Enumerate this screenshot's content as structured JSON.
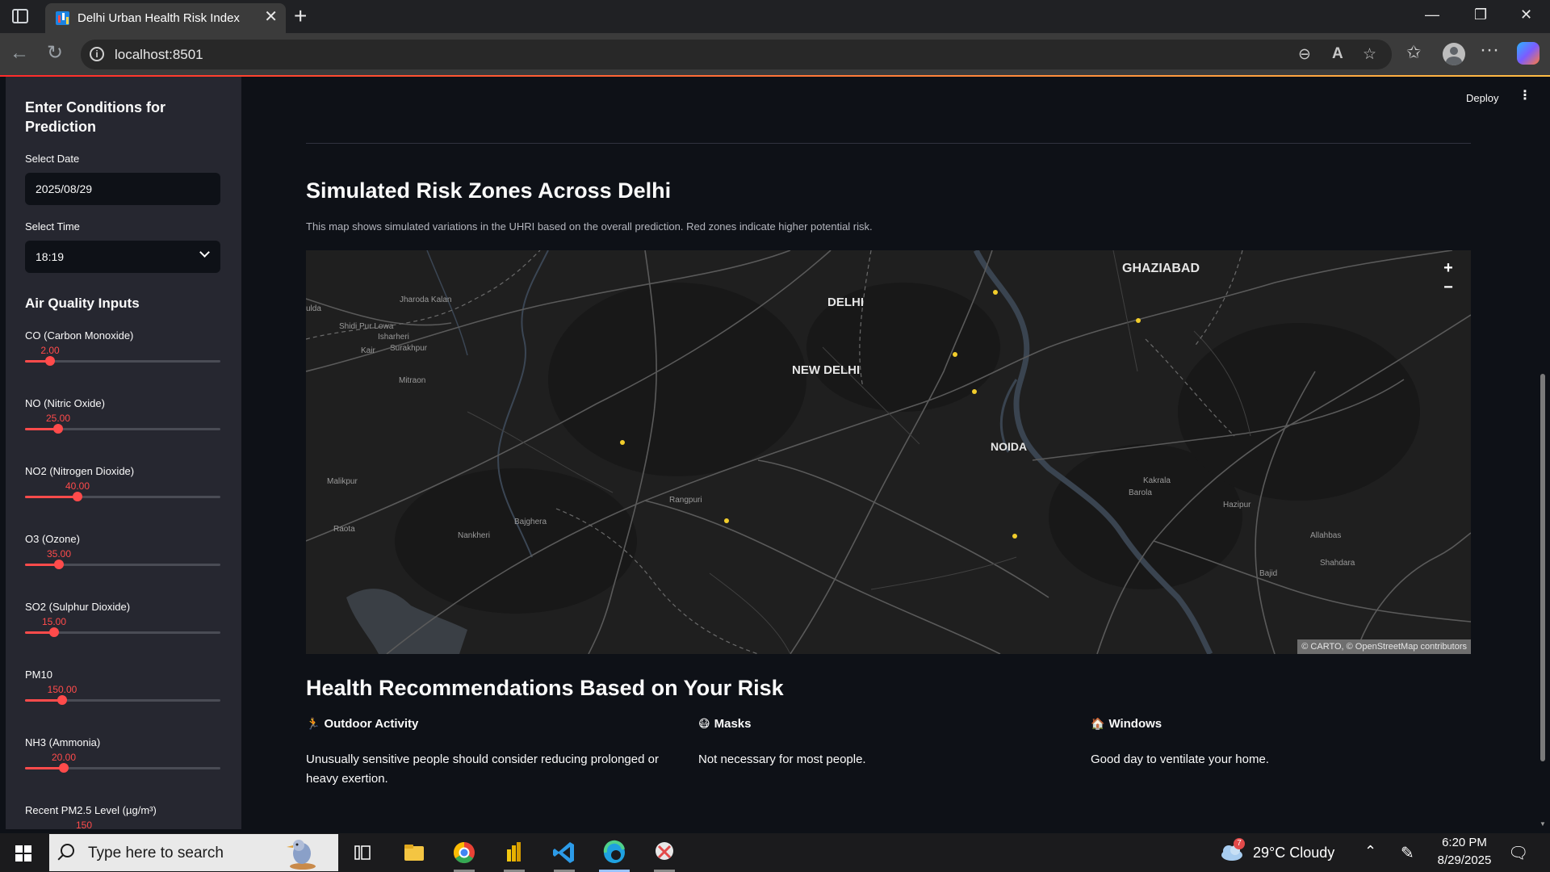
{
  "browser": {
    "tab_title": "Delhi Urban Health Risk Index",
    "url": "localhost:8501"
  },
  "app": {
    "deploy_label": "Deploy"
  },
  "sidebar": {
    "heading": "Enter Conditions for Prediction",
    "date_label": "Select Date",
    "date_value": "2025/08/29",
    "time_label": "Select Time",
    "time_value": "18:19",
    "aq_heading": "Air Quality Inputs",
    "sliders": [
      {
        "label": "CO (Carbon Monoxide)",
        "value": "2.00",
        "fraction": 0.13
      },
      {
        "label": "NO (Nitric Oxide)",
        "value": "25.00",
        "fraction": 0.17
      },
      {
        "label": "NO2 (Nitrogen Dioxide)",
        "value": "40.00",
        "fraction": 0.27
      },
      {
        "label": "O3 (Ozone)",
        "value": "35.00",
        "fraction": 0.175
      },
      {
        "label": "SO2 (Sulphur Dioxide)",
        "value": "15.00",
        "fraction": 0.15
      },
      {
        "label": "PM10",
        "value": "150.00",
        "fraction": 0.19
      },
      {
        "label": "NH3 (Ammonia)",
        "value": "20.00",
        "fraction": 0.2
      },
      {
        "label": "Recent PM2.5 Level (µg/m³)",
        "value": "150",
        "fraction": 0.3
      }
    ]
  },
  "main": {
    "map_section": {
      "title": "Simulated Risk Zones Across Delhi",
      "caption": "This map shows simulated variations in the UHRI based on the overall prediction. Red zones indicate higher potential risk.",
      "labels_major": [
        "GHAZIABAD",
        "DELHI",
        "NEW DELHI",
        "NOIDA"
      ],
      "labels_minor": [
        "Jharoda Kalan",
        "ulda",
        "Shidi Pur Lowa",
        "Isharheri",
        "Kair",
        "Surakhpur",
        "Mitraon",
        "Malikpur",
        "Raota",
        "Nankheri",
        "Bajghera",
        "Rangpuri",
        "Kakrala",
        "Barola",
        "Hazipur",
        "Allahbas",
        "Shahdara",
        "Bajid"
      ],
      "zoom_in": "+",
      "zoom_out": "−",
      "attribution": "© CARTO, © OpenStreetMap contributors"
    },
    "recommendations": {
      "title": "Health Recommendations Based on Your Risk",
      "items": [
        {
          "icon": "running-person-icon",
          "title": "Outdoor Activity",
          "text": "Unusually sensitive people should consider reducing prolonged or heavy exertion."
        },
        {
          "icon": "mask-face-icon",
          "title": "Masks",
          "text": "Not necessary for most people."
        },
        {
          "icon": "house-icon",
          "title": "Windows",
          "text": "Good day to ventilate your home."
        }
      ]
    }
  },
  "taskbar": {
    "search_placeholder": "Type here to search",
    "weather_badge": "7",
    "weather": "29°C  Cloudy",
    "time": "6:20 PM",
    "date": "8/29/2025"
  },
  "colors": {
    "accent": "#ff4b4b",
    "sidebar_bg": "#262730",
    "main_bg": "#0e1117",
    "risk_dot": "#f2cd2b"
  }
}
